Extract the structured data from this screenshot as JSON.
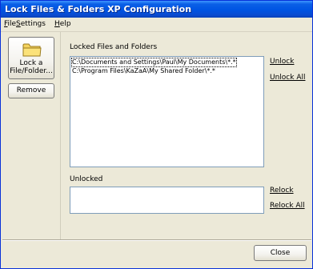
{
  "window": {
    "title": "Lock Files & Folders XP Configuration"
  },
  "menu": [
    {
      "accel": "F",
      "rest": "ile"
    },
    {
      "accel": "S",
      "rest": "ettings"
    },
    {
      "accel": "H",
      "rest": "elp"
    }
  ],
  "sidebar": {
    "lock_button_line1": "Lock a",
    "lock_button_line2": "File/Folder...",
    "remove_button": "Remove",
    "lock_icon": "folder-icon"
  },
  "locked": {
    "label": "Locked Files and Folders",
    "items": [
      "C:\\Documents and Settings\\Paul\\My Documents\\*.*",
      "C:\\Program Files\\KaZaA\\My Shared Folder\\*.*"
    ],
    "unlock_link": "Unlock",
    "unlock_all_link": "Unlock All"
  },
  "unlocked": {
    "label": "Unlocked",
    "items": [],
    "relock_link": "Relock",
    "relock_all_link": "Relock All"
  },
  "footer": {
    "close_button": "Close"
  },
  "colors": {
    "titlebar": "#0054e3",
    "face": "#ece9d8",
    "list_border": "#7f9db9"
  }
}
